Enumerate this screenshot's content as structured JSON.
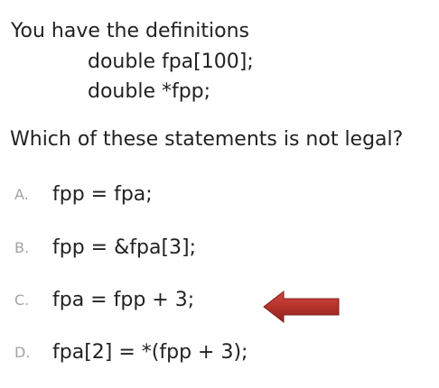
{
  "slide": {
    "intro": "You have the definitions",
    "definitions": [
      "double fpa[100];",
      "double *fpp;"
    ],
    "question": "Which of these statements is not legal?",
    "options": [
      {
        "letter": "A.",
        "text": "fpp = fpa;"
      },
      {
        "letter": "B.",
        "text": "fpp = &fpa[3];"
      },
      {
        "letter": "C.",
        "text": "fpa = fpp + 3;"
      },
      {
        "letter": "D.",
        "text": "fpa[2] = *(fpp + 3);"
      }
    ],
    "arrow_color": "#b5322b",
    "arrow_points_to": "C."
  }
}
